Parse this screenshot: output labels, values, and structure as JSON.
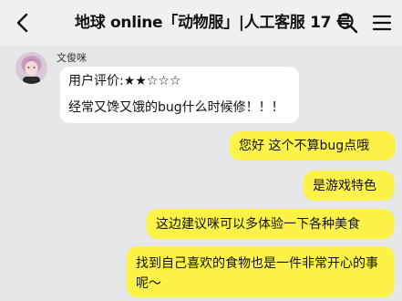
{
  "header": {
    "title": "地球 online「动物服」|人工客服 17 号"
  },
  "messages": {
    "incoming": {
      "sender": "文俊咪",
      "line1": "用户评价:★★☆☆☆",
      "line2": "经常又馋又饿的bug什么时候修！！！"
    },
    "outgoing": [
      "您好 这个不算bug点哦",
      "是游戏特色",
      "这边建议咪可以多体验一下各种美食",
      "找到自己喜欢的食物也是一件非常开心的事呢～"
    ]
  },
  "colors": {
    "background": "#e5e7e9",
    "outgoing_bubble": "#fdf247",
    "incoming_bubble": "#ffffff"
  },
  "icons": [
    "back-arrow-icon",
    "search-icon",
    "menu-icon"
  ]
}
